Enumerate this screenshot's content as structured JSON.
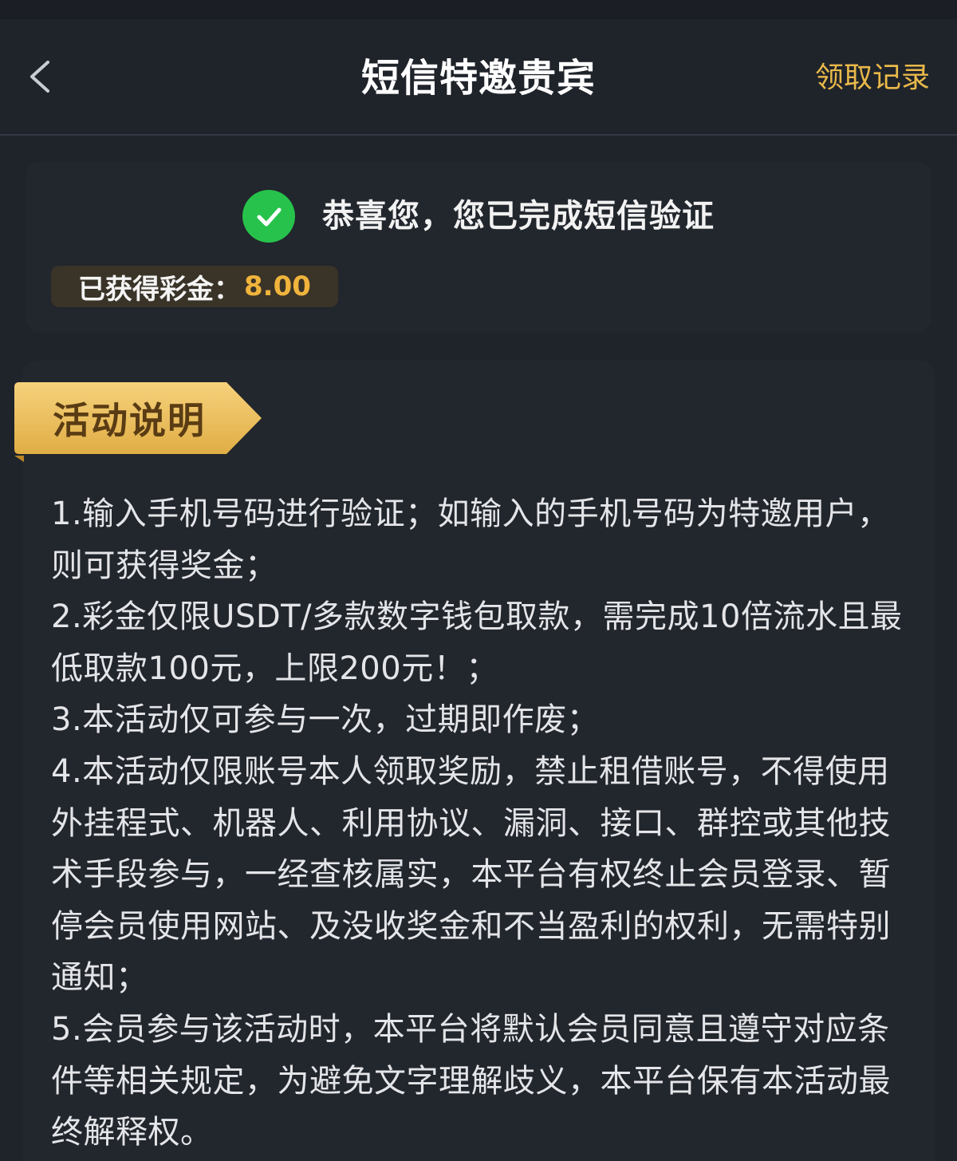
{
  "header": {
    "title": "短信特邀贵宾",
    "record_label": "领取记录",
    "back_icon": "chevron-left-icon"
  },
  "status": {
    "message": "恭喜您，您已完成短信验证",
    "bonus_label": "已获得彩金：",
    "bonus_value": "8.00",
    "icon": "check-circle-icon"
  },
  "description": {
    "title": "活动说明",
    "rules": [
      "1.输入手机号码进行验证；如输入的手机号码为特邀用户，则可获得奖金；",
      "2.彩金仅限USDT/多款数字钱包取款，需完成10倍流水且最低取款100元，上限200元！；",
      "3.本活动仅可参与一次，过期即作废；",
      "4.本活动仅限账号本人领取奖励，禁止租借账号，不得使用外挂程式、机器人、利用协议、漏洞、接口、群控或其他技术手段参与，一经查核属实，本平台有权终止会员登录、暂停会员使用网站、及没收奖金和不当盈利的权利，无需特别通知；",
      "5.会员参与该活动时，本平台将默认会员同意且遵守对应条件等相关规定，为避免文字理解歧义，本平台保有本活动最终解释权。"
    ]
  },
  "colors": {
    "background": "#1f232a",
    "card": "#22262d",
    "accent_gold": "#e9b94a",
    "success_green": "#27c24c"
  }
}
